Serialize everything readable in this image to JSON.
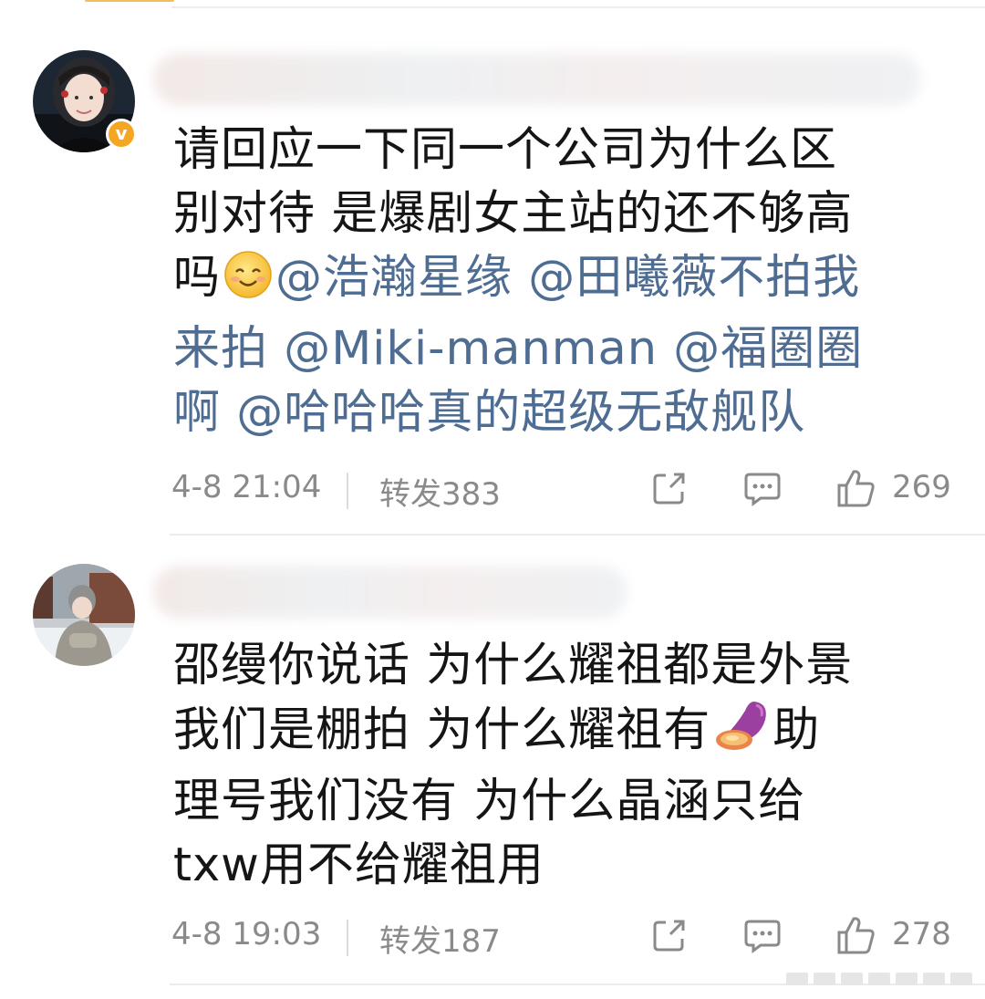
{
  "posts": [
    {
      "body": "请回应一下同一个公司为什么区别对待 是爆剧女主站的还不够高吗",
      "emoji_1": "smiling-face",
      "mentions": [
        "@浩瀚星缘",
        "@田曦薇不拍我来拍",
        "@Miki-manman",
        "@福圈圈啊",
        "@哈哈哈真的超级无敌舰队"
      ],
      "line1": "请回应一下同一个公司为什么区",
      "line2": "别对待 是爆剧女主站的还不够高",
      "line3_plain": "吗",
      "line3_m1": "@浩瀚星缘",
      "line3_m2": "@田曦薇不拍我",
      "line4_m2b": "来拍",
      "line4_m3": "@Miki-manman",
      "line4_m4": "@福圈圈",
      "line5_m4b": "啊",
      "line5_m5": "@哈哈哈真的超级无敌舰队",
      "time": "4-8 21:04",
      "repost": "转发383",
      "likes": "269",
      "verified": true
    },
    {
      "line1": "邵缦你说话 为什么耀祖都是外景",
      "line2a": "我们是棚拍 为什么耀祖有",
      "line2b": "助",
      "line3": "理号我们没有 为什么晶涵只给",
      "line4": "txw用不给耀祖用",
      "emoji_1": "sweet-potato",
      "time": "4-8 19:03",
      "repost": "转发187",
      "likes": "278"
    }
  ],
  "colors": {
    "mention": "#4f6d92",
    "meta": "#8a8a8a",
    "verified_badge": "#f5a623"
  },
  "icons": [
    "share-icon",
    "comment-icon",
    "like-icon",
    "verified-icon"
  ]
}
